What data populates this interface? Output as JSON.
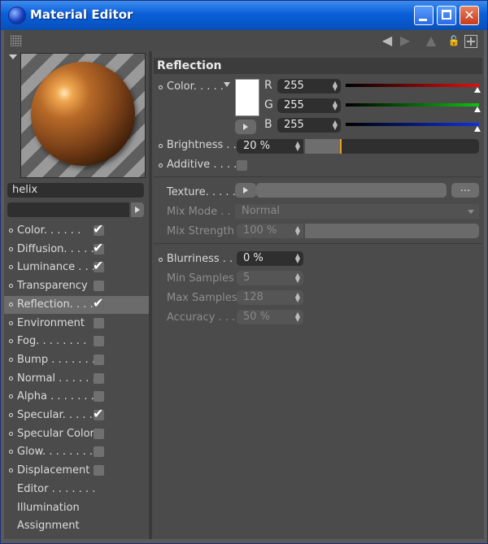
{
  "window": {
    "title": "Material Editor",
    "min_label": "",
    "close_label": "✕"
  },
  "toolbar": {
    "back_icon": "◀",
    "forward_icon": "▶",
    "up_icon": "▲",
    "lock_icon": "🔓",
    "new_icon": "+"
  },
  "left": {
    "material_name": "helix",
    "channels": [
      {
        "label": "Color. . . . . .",
        "checked": true
      },
      {
        "label": "Diffusion. . . . . .",
        "checked": true
      },
      {
        "label": "Luminance . . .",
        "checked": true
      },
      {
        "label": "Transparency",
        "checked": false
      },
      {
        "label": "Reflection. . . .",
        "checked": true
      },
      {
        "label": "Environment",
        "checked": false
      },
      {
        "label": "Fog. . . . . . . .",
        "checked": false
      },
      {
        "label": "Bump . . . . . . .",
        "checked": false
      },
      {
        "label": "Normal . . . . . .",
        "checked": false
      },
      {
        "label": "Alpha . . . . . . .",
        "checked": false
      },
      {
        "label": "Specular. . . . .",
        "checked": true
      },
      {
        "label": "Specular Color",
        "checked": false
      },
      {
        "label": "Glow. . . . . . . .",
        "checked": false
      },
      {
        "label": "Displacement",
        "checked": false
      },
      {
        "label": "Editor . . . . . . ."
      },
      {
        "label": "Illumination"
      },
      {
        "label": "Assignment"
      }
    ],
    "check_mark": "✔"
  },
  "reflection": {
    "header": "Reflection",
    "color_label": "Color. . . . .",
    "r_label": "R",
    "g_label": "G",
    "b_label": "B",
    "r": "255",
    "g": "255",
    "b": "255",
    "brightness_label": "Brightness . .",
    "brightness": "20 %",
    "brightness_fraction": 0.2,
    "additive_label": "Additive . . . .",
    "texture_label": "Texture. . . . .",
    "texture_dots": "...",
    "mix_mode_label": "Mix Mode . . .",
    "mix_mode": "Normal",
    "mix_strength_label": "Mix Strength",
    "mix_strength": "100 %",
    "blurriness_label": "Blurriness . . .",
    "blurriness": "0 %",
    "min_samples_label": "Min Samples",
    "min_samples": "5",
    "max_samples_label": "Max Samples",
    "max_samples": "128",
    "accuracy_label": "Accuracy . . .",
    "accuracy": "50 %"
  },
  "colors": {
    "title_bar": "#0a5fd8",
    "panel": "#4b4b4b",
    "red": "#e01010",
    "green": "#10c010",
    "blue": "#1030e0",
    "accent": "#e8a020"
  }
}
